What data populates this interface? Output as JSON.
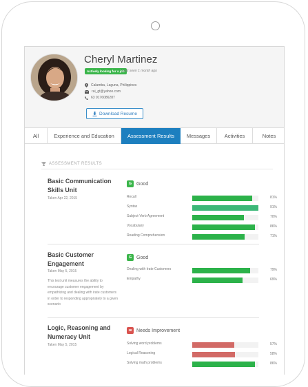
{
  "profile": {
    "name": "Cheryl Martinez",
    "status_badge": "Actively looking for a job",
    "last_seen": "Last seen 1 month ago",
    "location": "Calamba, Laguna, Philippines",
    "email": "rai_gt@yahoo.com",
    "phone": "63 9176086287",
    "download_label": "Download Resume"
  },
  "tabs": [
    {
      "label": "All"
    },
    {
      "label": "Experience and Education"
    },
    {
      "label": "Assessment Results",
      "active": true
    },
    {
      "label": "Messages"
    },
    {
      "label": "Activities"
    },
    {
      "label": "Notes"
    }
  ],
  "section_title": "ASSESSMENT RESULTS",
  "colors": {
    "good": "#3ab54a",
    "needs_improvement": "#d9534f",
    "bar_green": "#2cb24a",
    "bar_highlight": "#3cb878",
    "bar_red": "#d26a66",
    "tab_active": "#1d7fbf"
  },
  "assessments": [
    {
      "title": "Basic Communication Skills Unit",
      "date": "Taken Apr 22, 2015",
      "description": "",
      "grade_letter": "G",
      "grade": "Good",
      "skills": [
        {
          "name": "Recall",
          "value": 81,
          "pct": "81%"
        },
        {
          "name": "Syntax",
          "value": 91,
          "pct": "91%"
        },
        {
          "name": "Subject-Verb Agreement",
          "value": 70,
          "pct": "70%"
        },
        {
          "name": "Vocabulary",
          "value": 86,
          "pct": "86%"
        },
        {
          "name": "Reading Comprehension",
          "value": 71,
          "pct": "71%"
        }
      ]
    },
    {
      "title": "Basic Customer Engagement",
      "date": "Taken May 5, 2015",
      "description": "This test unit measures the ability to encourage customer engagement by empathizing and dealing with irate customers in order to responding appropriately to a given scenario",
      "grade_letter": "G",
      "grade": "Good",
      "skills": [
        {
          "name": "Dealing with Irate Customers",
          "value": 79,
          "pct": "79%"
        },
        {
          "name": "Empathy",
          "value": 69,
          "pct": "69%"
        }
      ]
    },
    {
      "title": "Logic, Reasoning and Numeracy Unit",
      "date": "Taken May 5, 2015",
      "description": "",
      "grade_letter": "NI",
      "grade": "Needs Improvement",
      "skills": [
        {
          "name": "Solving word problems",
          "value": 57,
          "pct": "57%"
        },
        {
          "name": "Logical Reasoning",
          "value": 58,
          "pct": "58%"
        },
        {
          "name": "Solving math problems",
          "value": 86,
          "pct": "86%"
        }
      ]
    }
  ]
}
